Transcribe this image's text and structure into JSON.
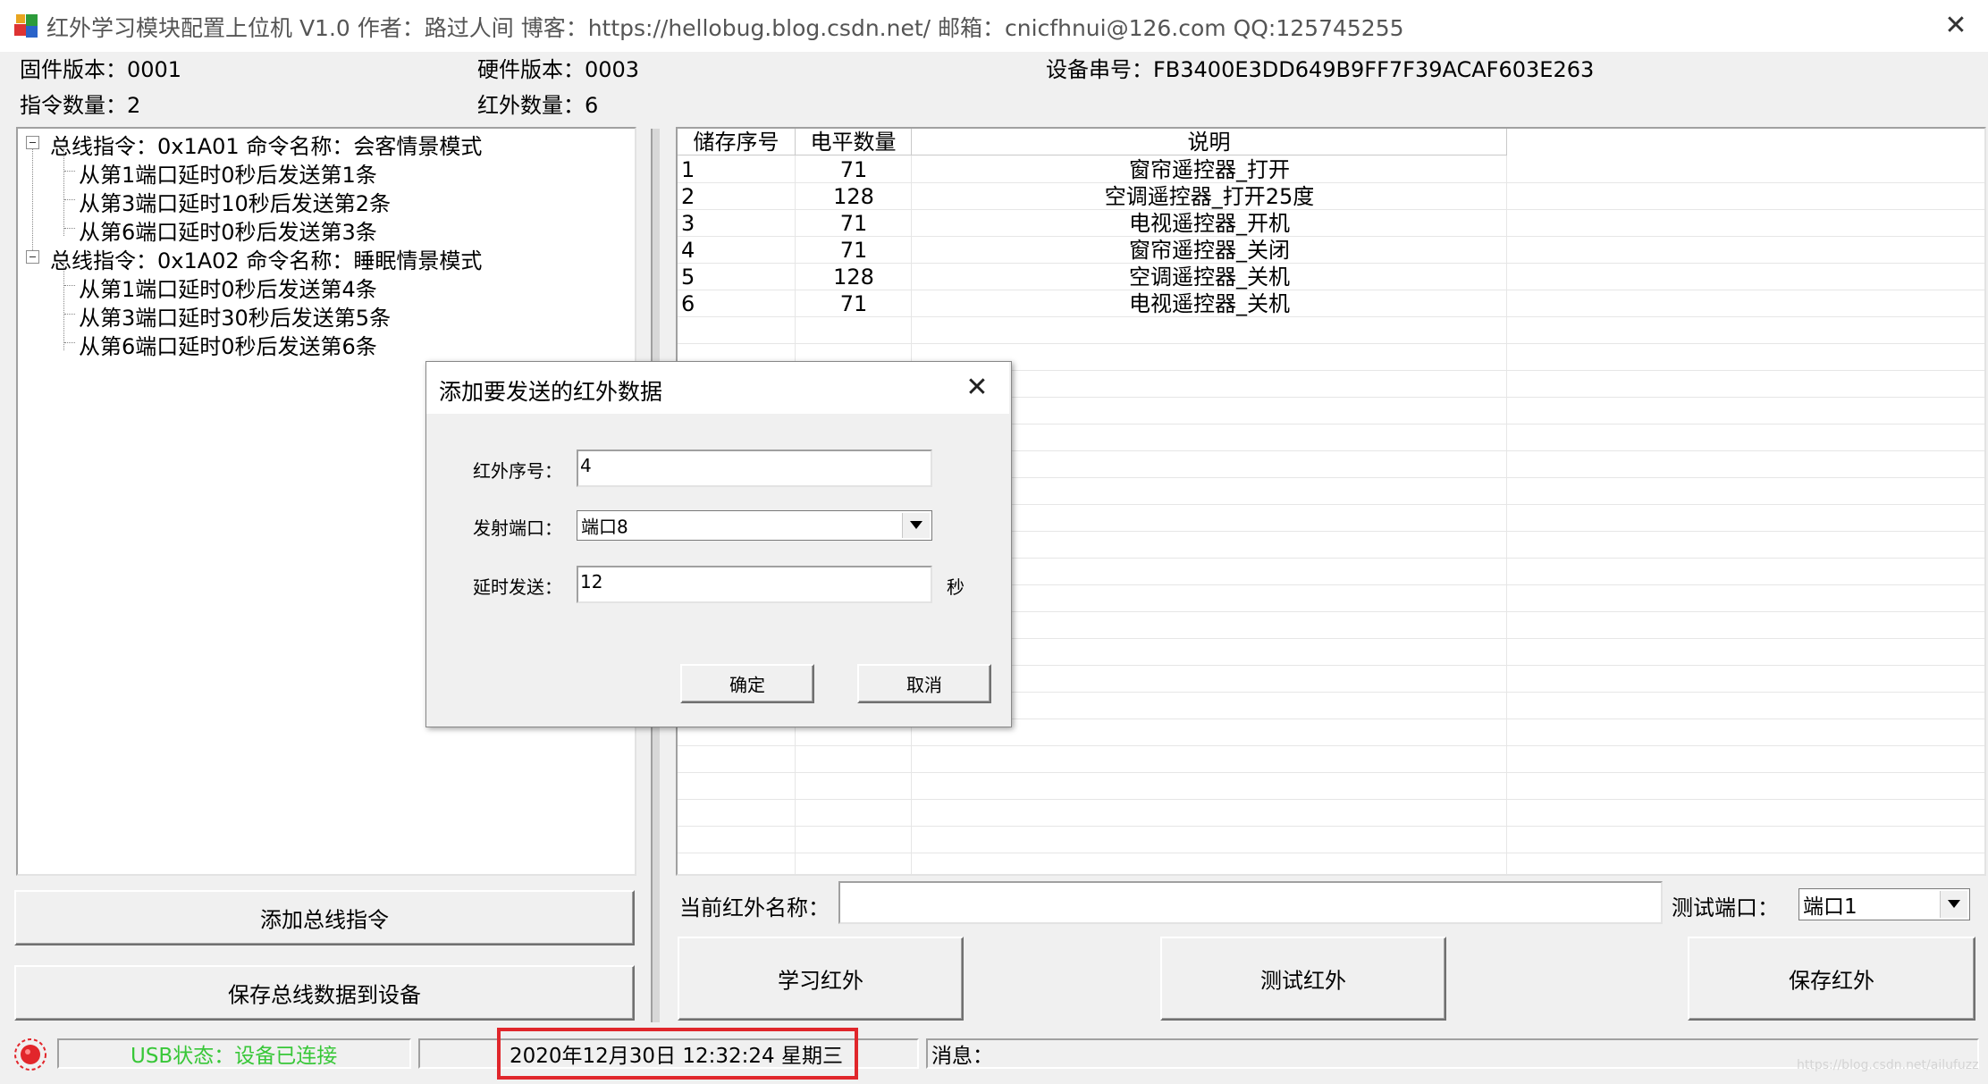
{
  "window": {
    "title": "红外学习模块配置上位机 V1.0 作者：路过人间 博客：https://hellobug.blog.csdn.net/ 邮箱：cnicfhnui@126.com QQ:125745255",
    "close_icon": "close-icon"
  },
  "info": {
    "firmware_label": "固件版本：",
    "firmware_value": "0001",
    "hardware_label": "硬件版本：",
    "hardware_value": "0003",
    "serial_label": "设备串号：",
    "serial_value": "FB3400E3DD649B9FF7F39ACAF603E263",
    "cmd_count_label": "指令数量：",
    "cmd_count_value": "2",
    "ir_count_label": "红外数量：",
    "ir_count_value": "6"
  },
  "tree": {
    "nodes": [
      {
        "label": "总线指令：0x1A01  命令名称：会客情景模式"
      },
      {
        "label": "从第1端口延时0秒后发送第1条"
      },
      {
        "label": "从第3端口延时10秒后发送第2条"
      },
      {
        "label": "从第6端口延时0秒后发送第3条"
      },
      {
        "label": "总线指令：0x1A02  命令名称：睡眠情景模式"
      },
      {
        "label": "从第1端口延时0秒后发送第4条"
      },
      {
        "label": "从第3端口延时30秒后发送第5条"
      },
      {
        "label": "从第6端口延时0秒后发送第6条"
      }
    ]
  },
  "table": {
    "headers": [
      "储存序号",
      "电平数量",
      "说明"
    ],
    "rows": [
      [
        "1",
        "71",
        "窗帘遥控器_打开"
      ],
      [
        "2",
        "128",
        "空调遥控器_打开25度"
      ],
      [
        "3",
        "71",
        "电视遥控器_开机"
      ],
      [
        "4",
        "71",
        "窗帘遥控器_关闭"
      ],
      [
        "5",
        "128",
        "空调遥控器_关机"
      ],
      [
        "6",
        "71",
        "电视遥控器_关机"
      ]
    ]
  },
  "left_buttons": {
    "add_bus_cmd": "添加总线指令",
    "save_bus_data": "保存总线数据到设备"
  },
  "ir_controls": {
    "name_label": "当前红外名称：",
    "name_value": "",
    "test_port_label": "测试端口：",
    "test_port_value": "端口1",
    "learn_button": "学习红外",
    "test_button": "测试红外",
    "save_button": "保存红外"
  },
  "status": {
    "led_icon": "red-led-icon",
    "usb_status": "USB状态：设备已连接",
    "usb_color": "#38c738",
    "datetime": "2020年12月30日  12:32:24  星期三",
    "message_label": "消息：",
    "highlight_color": "#e0262b"
  },
  "dialog": {
    "title": "添加要发送的红外数据",
    "ir_index_label": "红外序号：",
    "ir_index_value": "4",
    "port_label": "发射端口：",
    "port_value": "端口8",
    "delay_label": "延时发送：",
    "delay_value": "12",
    "delay_unit": "秒",
    "ok_button": "确定",
    "cancel_button": "取消"
  },
  "watermark": "https://blog.csdn.net/ailufuzz"
}
